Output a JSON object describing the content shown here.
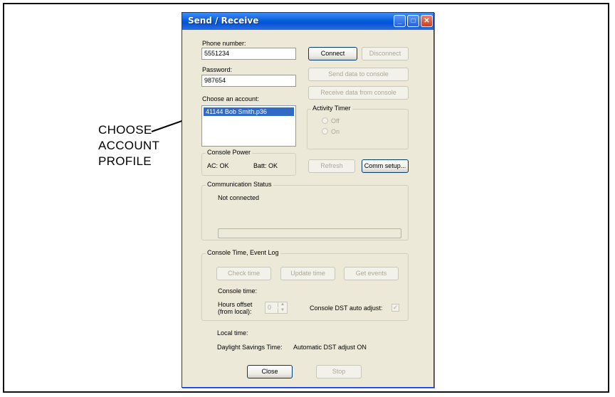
{
  "callout": {
    "line1": "CHOOSE",
    "line2": "ACCOUNT",
    "line3": "PROFILE"
  },
  "window": {
    "title": "Send / Receive",
    "controls": {
      "minimize": "minimize-icon",
      "maximize": "maximize-icon",
      "close": "close-icon"
    }
  },
  "phone": {
    "label": "Phone number:",
    "value": "5551234"
  },
  "password": {
    "label": "Password:",
    "value": "987654"
  },
  "account": {
    "label": "Choose an account:",
    "items": [
      "41144 Bob Smith.p36"
    ]
  },
  "buttons": {
    "connect": "Connect",
    "disconnect": "Disconnect",
    "send": "Send data to console",
    "receive": "Receive data from console",
    "refresh": "Refresh",
    "comm_setup": "Comm setup...",
    "check_time": "Check time",
    "update_time": "Update time",
    "get_events": "Get events",
    "close": "Close",
    "stop": "Stop"
  },
  "activity_timer": {
    "title": "Activity Timer",
    "off": "Off",
    "on": "On"
  },
  "console_power": {
    "title": "Console Power",
    "ac": "AC:  OK",
    "batt": "Batt:  OK"
  },
  "comm_status": {
    "title": "Communication Status",
    "text": "Not connected",
    "progress": 0
  },
  "console_time": {
    "title": "Console Time, Event Log",
    "console_time_label": "Console time:",
    "hours_offset_label_1": "Hours offset",
    "hours_offset_label_2": "(from local):",
    "hours_offset_value": "0",
    "dst_label": "Console DST auto adjust:",
    "dst_checked": true
  },
  "local_time_label": "Local time:",
  "dst_row": {
    "label": "Daylight Savings Time:",
    "value": "Automatic DST adjust ON"
  },
  "colors": {
    "title_bar": "#0553d6",
    "selection": "#316ac5",
    "window_bg": "#ece9d8"
  }
}
